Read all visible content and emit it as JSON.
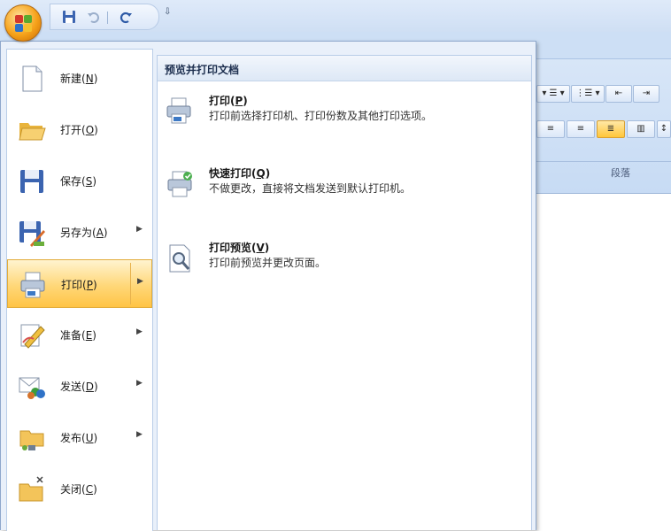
{
  "qat": {
    "more_glyph": "⇩"
  },
  "office_button": {
    "colors": [
      "#d5372b",
      "#5aa92f",
      "#2f72c7",
      "#f5c02d"
    ]
  },
  "ribbon": {
    "group_label": "段落"
  },
  "file_menu": {
    "items": [
      {
        "label": "新建",
        "key": "N",
        "icon": "new-document-icon",
        "has_submenu": false,
        "selected": false
      },
      {
        "label": "打开",
        "key": "O",
        "icon": "open-folder-icon",
        "has_submenu": false,
        "selected": false
      },
      {
        "label": "保存",
        "key": "S",
        "icon": "save-disk-icon",
        "has_submenu": false,
        "selected": false
      },
      {
        "label": "另存为",
        "key": "A",
        "icon": "save-as-icon",
        "has_submenu": true,
        "selected": false
      },
      {
        "label": "打印",
        "key": "P",
        "icon": "printer-icon",
        "has_submenu": true,
        "selected": true
      },
      {
        "label": "准备",
        "key": "E",
        "icon": "prepare-pencil-icon",
        "has_submenu": true,
        "selected": false
      },
      {
        "label": "发送",
        "key": "D",
        "icon": "send-mail-icon",
        "has_submenu": true,
        "selected": false
      },
      {
        "label": "发布",
        "key": "U",
        "icon": "publish-folder-icon",
        "has_submenu": true,
        "selected": false
      },
      {
        "label": "关闭",
        "key": "C",
        "icon": "close-folder-icon",
        "has_submenu": false,
        "selected": false
      }
    ]
  },
  "submenu": {
    "title": "预览并打印文档",
    "options": [
      {
        "title": "打印",
        "key": "P",
        "description": "打印前选择打印机、打印份数及其他打印选项。",
        "icon": "printer-icon"
      },
      {
        "title": "快速打印",
        "key": "Q",
        "description": "不做更改，直接将文档发送到默认打印机。",
        "icon": "quick-print-icon"
      },
      {
        "title": "打印预览",
        "key": "V",
        "description": "打印前预览并更改页面。",
        "icon": "print-preview-icon"
      }
    ]
  },
  "accent_colors": {
    "highlight": "#ffd778",
    "menu_bg": "#e9f0fa",
    "border": "#8ea7cc"
  }
}
